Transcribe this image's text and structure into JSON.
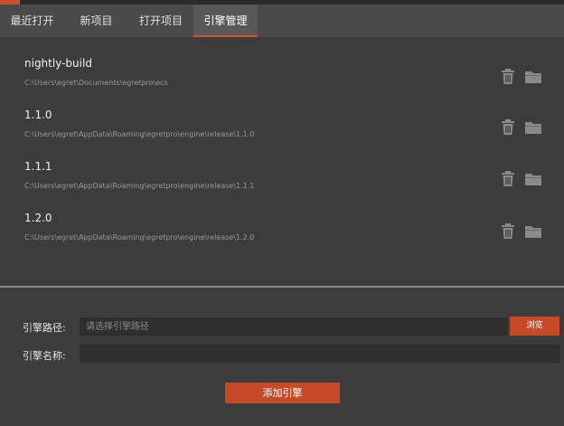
{
  "tabs": [
    {
      "label": "最近打开",
      "active": false
    },
    {
      "label": "新项目",
      "active": false
    },
    {
      "label": "打开项目",
      "active": false
    },
    {
      "label": "引擎管理",
      "active": true
    }
  ],
  "engines": [
    {
      "name": "nightly-build",
      "path": "C:\\Users\\egret\\Documents\\egretpro\\ecs"
    },
    {
      "name": "1.1.0",
      "path": "C:\\Users\\egret\\AppData\\Roaming\\egretpro\\engine\\release\\1.1.0"
    },
    {
      "name": "1.1.1",
      "path": "C:\\Users\\egret\\AppData\\Roaming\\egretpro\\engine\\release\\1.1.1"
    },
    {
      "name": "1.2.0",
      "path": "C:\\Users\\egret\\AppData\\Roaming\\egretpro\\engine\\release\\1.2.0"
    }
  ],
  "icons": {
    "delete": "trash-icon",
    "open": "folder-icon"
  },
  "form": {
    "path_label": "引擎路径:",
    "path_placeholder": "请选择引擎路径",
    "path_value": "",
    "name_label": "引擎名称:",
    "name_value": "",
    "browse_label": "浏览",
    "add_label": "添加引擎"
  },
  "colors": {
    "accent": "#c44a28",
    "background": "#3c3c3c",
    "tabbar": "#4a4a4a",
    "icon": "#8a8a8a"
  }
}
